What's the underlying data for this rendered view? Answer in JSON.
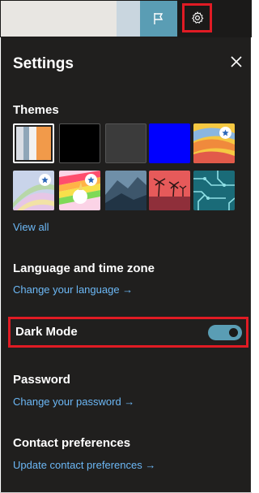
{
  "header": {
    "flag_icon": "flag-icon",
    "settings_icon": "gear-icon"
  },
  "panel": {
    "title": "Settings",
    "close_icon": "close-icon"
  },
  "themes": {
    "heading": "Themes",
    "view_all": "View all",
    "items": [
      {
        "name": "theme-stripes",
        "selected": true
      },
      {
        "name": "theme-black"
      },
      {
        "name": "theme-dark-gray"
      },
      {
        "name": "theme-blue"
      },
      {
        "name": "theme-sunset-waves",
        "premium": true
      },
      {
        "name": "theme-pastel-swirl",
        "premium": true
      },
      {
        "name": "theme-rainbow-unicorn",
        "premium": true
      },
      {
        "name": "theme-mountains"
      },
      {
        "name": "theme-palm-trees"
      },
      {
        "name": "theme-circuit"
      }
    ]
  },
  "language": {
    "heading": "Language and time zone",
    "link": "Change your language →"
  },
  "dark_mode": {
    "label": "Dark Mode",
    "enabled": true
  },
  "password": {
    "heading": "Password",
    "link": "Change your password →"
  },
  "contact": {
    "heading": "Contact preferences",
    "link": "Update contact preferences →"
  },
  "colors": {
    "accent": "#5a9db4",
    "link": "#6cb8f6",
    "highlight": "#e01b24",
    "panel_bg": "#201f1e"
  }
}
